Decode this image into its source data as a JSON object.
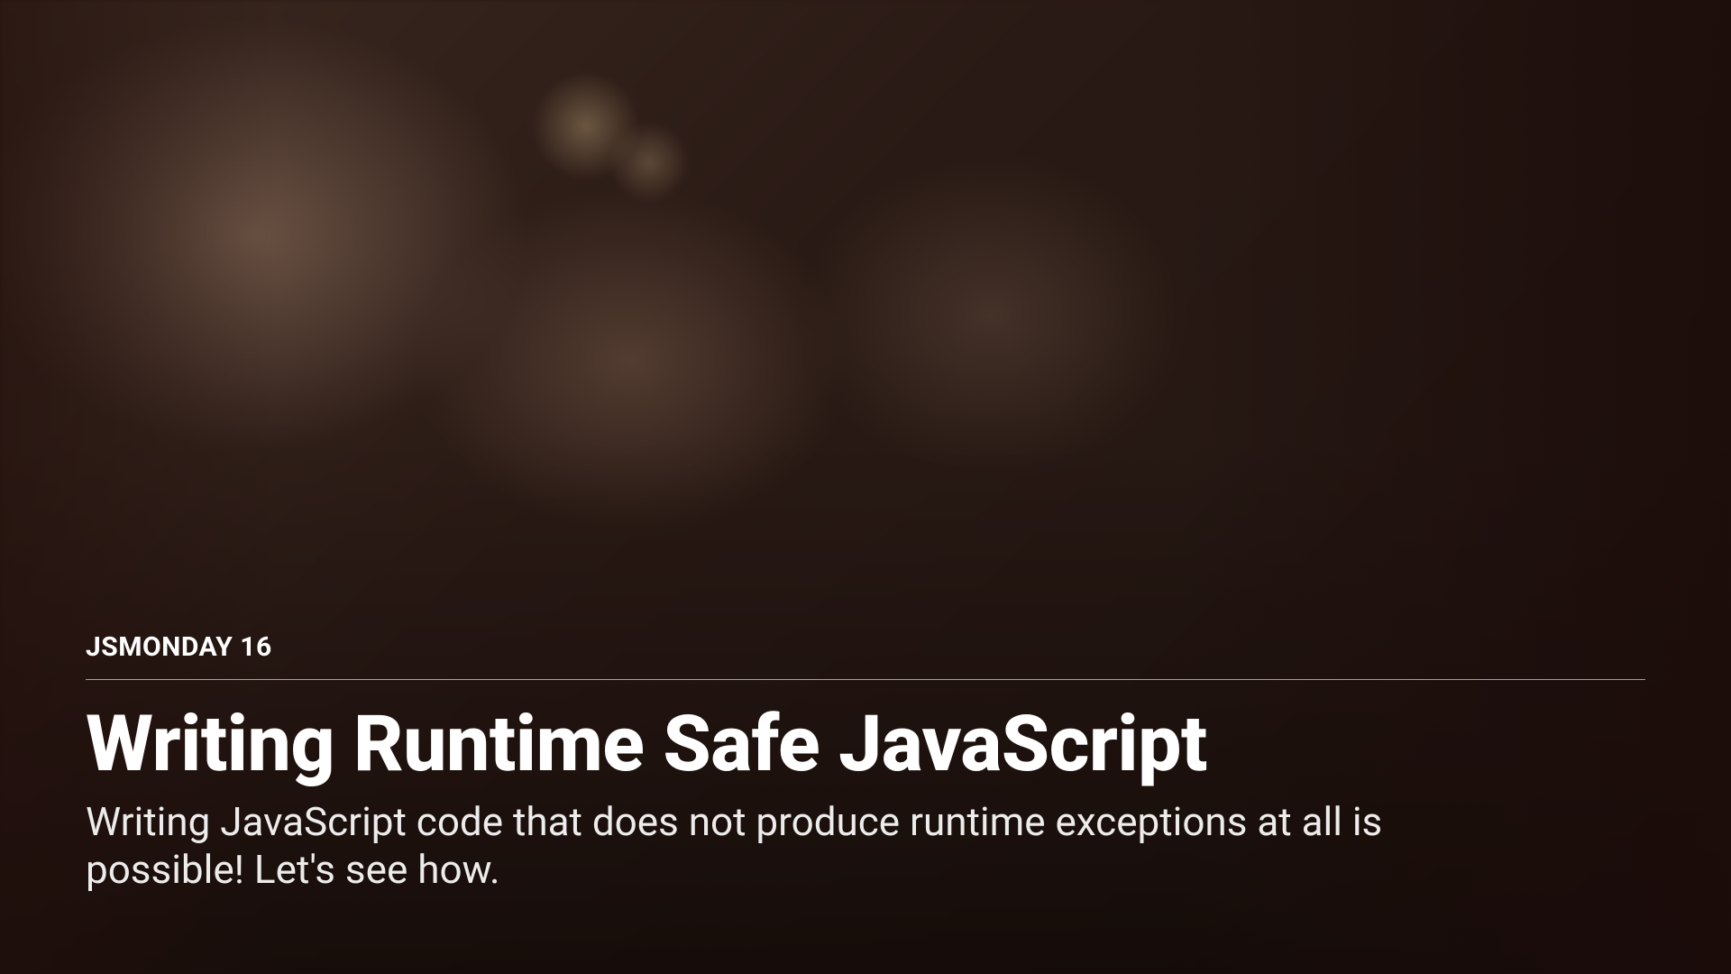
{
  "hero": {
    "eyebrow": "JSMONDAY 16",
    "title": "Writing Runtime Safe JavaScript",
    "subtitle": "Writing JavaScript code that does not produce runtime exceptions at all is possible! Let's see how."
  }
}
